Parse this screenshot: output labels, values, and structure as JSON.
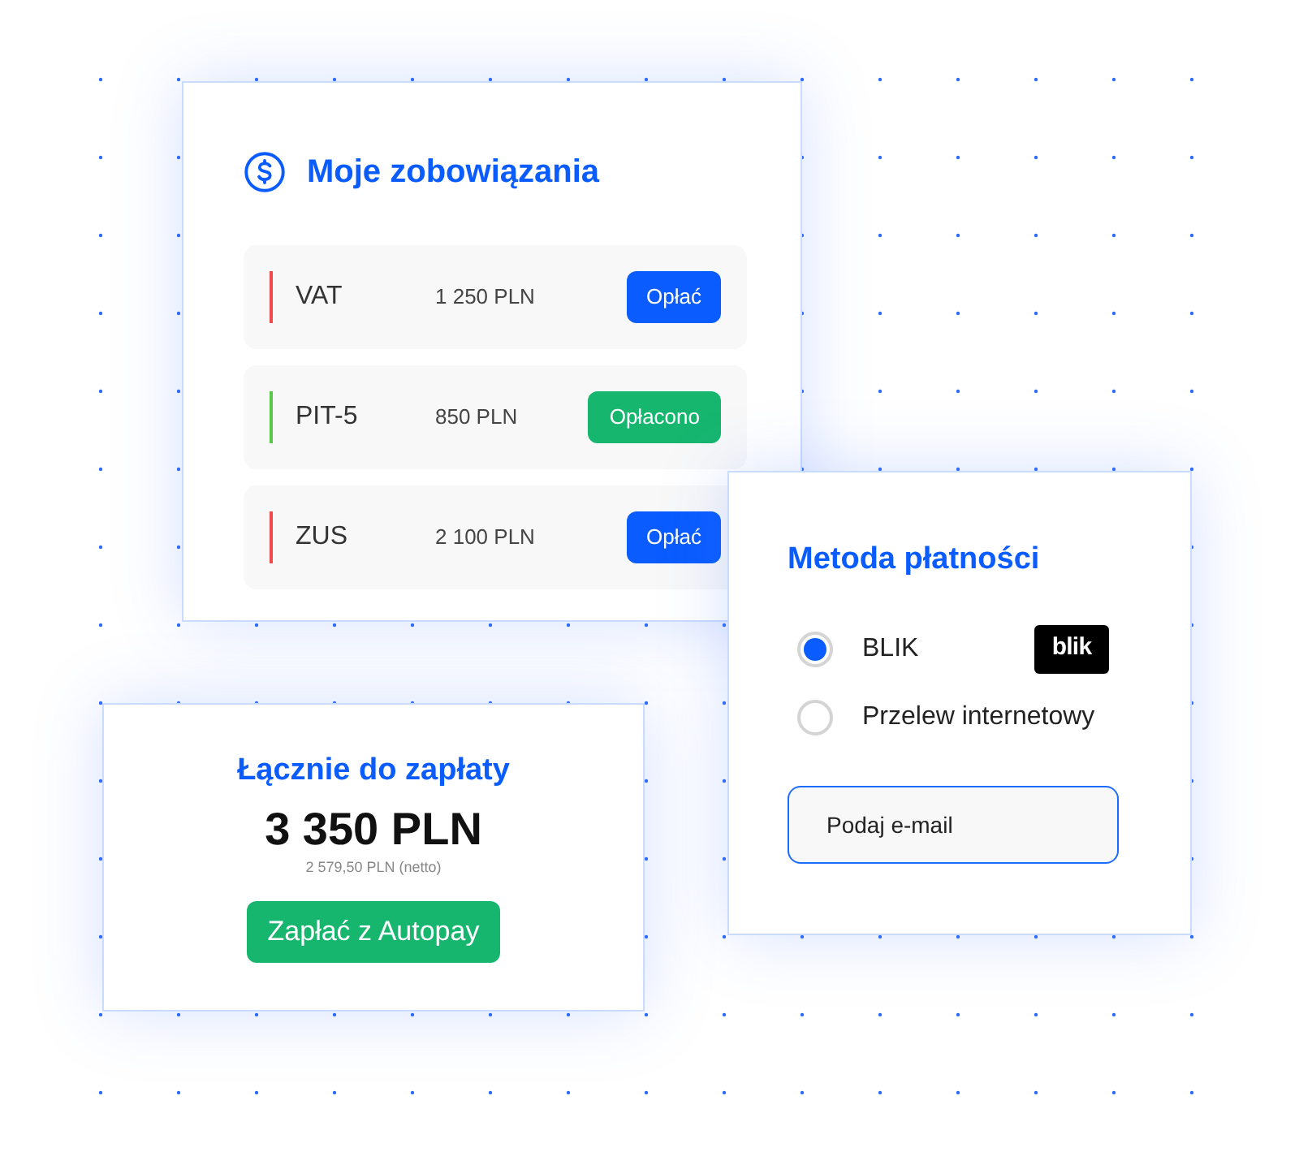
{
  "obligations": {
    "title": "Moje zobowiązania",
    "rows": [
      {
        "name": "VAT",
        "amount": "1 250 PLN",
        "action": "Opłać",
        "paid": false
      },
      {
        "name": "PIT-5",
        "amount": "850 PLN",
        "action": "Opłacono",
        "paid": true
      },
      {
        "name": "ZUS",
        "amount": "2 100 PLN",
        "action": "Opłać",
        "paid": false
      }
    ]
  },
  "payment_method": {
    "title": "Metoda płatności",
    "options": [
      {
        "label": "BLIK",
        "selected": true,
        "logo": "blik"
      },
      {
        "label": "Przelew internetowy",
        "selected": false
      }
    ],
    "email": {
      "placeholder": "Podaj e-mail"
    }
  },
  "total": {
    "title": "Łącznie do zapłaty",
    "amount": "3 350 PLN",
    "net": "2 579,50 PLN (netto)",
    "button": "Zapłać z Autopay"
  }
}
